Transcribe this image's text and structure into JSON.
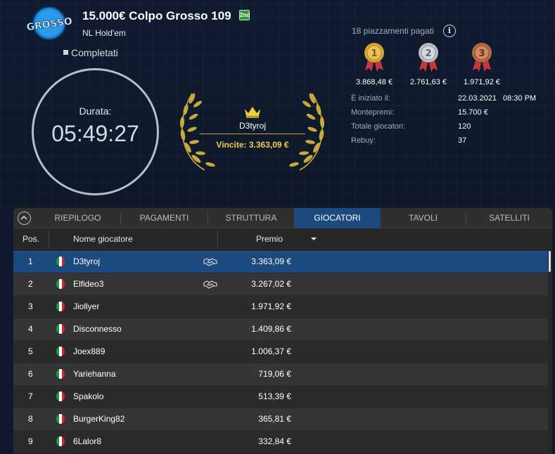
{
  "header": {
    "logo_text": "GROSSO",
    "title": "15.000€ Colpo Grosso 109",
    "badge": "2nd",
    "game_type": "NL Hold'em",
    "status": "Completati"
  },
  "timer": {
    "label": "Durata:",
    "value": "05:49:27"
  },
  "winner": {
    "name": "D3tyroj",
    "prize_text": "Vincite: 3.363,09 €"
  },
  "payouts": {
    "paid_places": "18 piazzamenti pagati",
    "medals": [
      {
        "rank": "1",
        "amount": "3.868,48 €",
        "color": "#d6a530"
      },
      {
        "rank": "2",
        "amount": "2.761,63 €",
        "color": "#b8bcc2"
      },
      {
        "rank": "3",
        "amount": "1.971,92 €",
        "color": "#b46a45"
      }
    ]
  },
  "details": [
    {
      "label": "È iniziato il:",
      "value": "22.03.2021",
      "value2": "08:30 PM"
    },
    {
      "label": "Montepremi:",
      "value": "15.700 €"
    },
    {
      "label": "Totale giocatori:",
      "value": "120"
    },
    {
      "label": "Rebuy:",
      "value": "37"
    }
  ],
  "tabs": [
    "RIEPILOGO",
    "PAGAMENTI",
    "STRUTTURA",
    "GIOCATORI",
    "TAVOLI",
    "SATELLITI"
  ],
  "active_tab": "GIOCATORI",
  "table": {
    "headers": {
      "pos": "Pos.",
      "name": "Nome giocatore",
      "prize": "Premio"
    },
    "rows": [
      {
        "pos": "1",
        "name": "D3tyroj",
        "prize": "3.363,09 €",
        "deal": true
      },
      {
        "pos": "2",
        "name": "Elfideo3",
        "prize": "3.267,02 €",
        "deal": true
      },
      {
        "pos": "3",
        "name": "Jiollyer",
        "prize": "1.971,92 €",
        "deal": false
      },
      {
        "pos": "4",
        "name": "Disconnesso",
        "prize": "1.409,86 €",
        "deal": false
      },
      {
        "pos": "5",
        "name": "Joex889",
        "prize": "1.006,37 €",
        "deal": false
      },
      {
        "pos": "6",
        "name": "Yariehanna",
        "prize": "719,06 €",
        "deal": false
      },
      {
        "pos": "7",
        "name": "Spakolo",
        "prize": "513,39 €",
        "deal": false
      },
      {
        "pos": "8",
        "name": "BurgerKing82",
        "prize": "365,81 €",
        "deal": false
      },
      {
        "pos": "9",
        "name": "6Lalor8",
        "prize": "332,84 €",
        "deal": false
      }
    ]
  },
  "colors": {
    "accent_blue": "#1c4a7e",
    "gold": "#f1cd3f",
    "background": "#0f1a2e"
  }
}
